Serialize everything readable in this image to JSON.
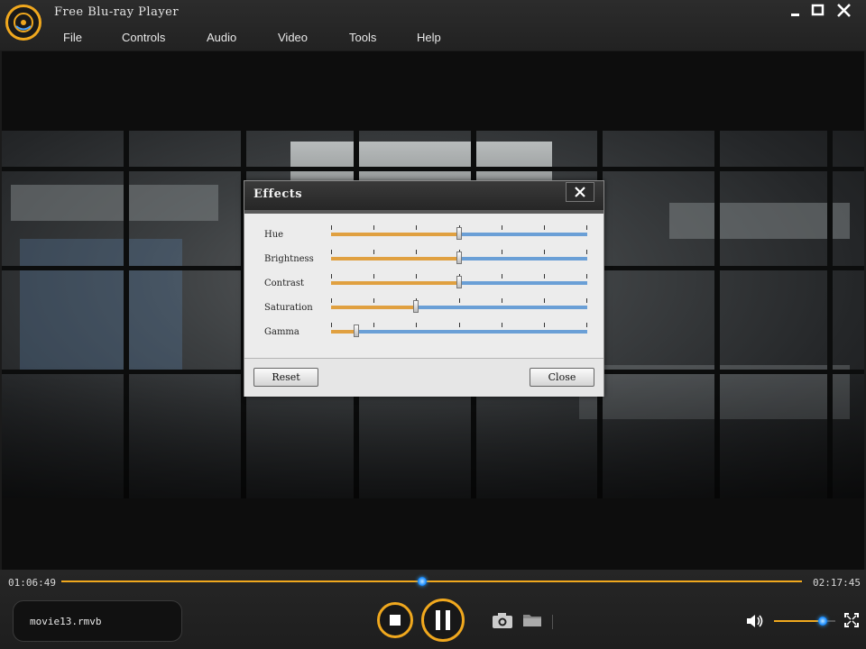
{
  "app": {
    "title": "Free Blu-ray Player"
  },
  "menu": [
    "File",
    "Controls",
    "Audio",
    "Video",
    "Tools",
    "Help"
  ],
  "effects_dialog": {
    "title": "Effects",
    "sliders": [
      {
        "label": "Hue",
        "value": 0.5
      },
      {
        "label": "Brightness",
        "value": 0.5
      },
      {
        "label": "Contrast",
        "value": 0.5
      },
      {
        "label": "Saturation",
        "value": 0.33
      },
      {
        "label": "Gamma",
        "value": 0.1
      }
    ],
    "reset_label": "Reset",
    "close_label": "Close"
  },
  "playback": {
    "current_time": "01:06:49",
    "total_time": "02:17:45",
    "progress": 0.487,
    "filename": "movie13.rmvb",
    "volume": 0.8
  },
  "colors": {
    "accent": "#f0a81e",
    "track": "#6a9fd6",
    "thumb": "#1a8cff"
  },
  "icons": {
    "logo": "disc-logo-icon",
    "minimize": "minimize-icon",
    "maximize": "maximize-icon",
    "close": "close-icon",
    "stop": "stop-icon",
    "pause": "pause-icon",
    "snapshot": "camera-icon",
    "open": "folder-icon",
    "volume": "speaker-icon",
    "fullscreen": "fullscreen-icon"
  }
}
